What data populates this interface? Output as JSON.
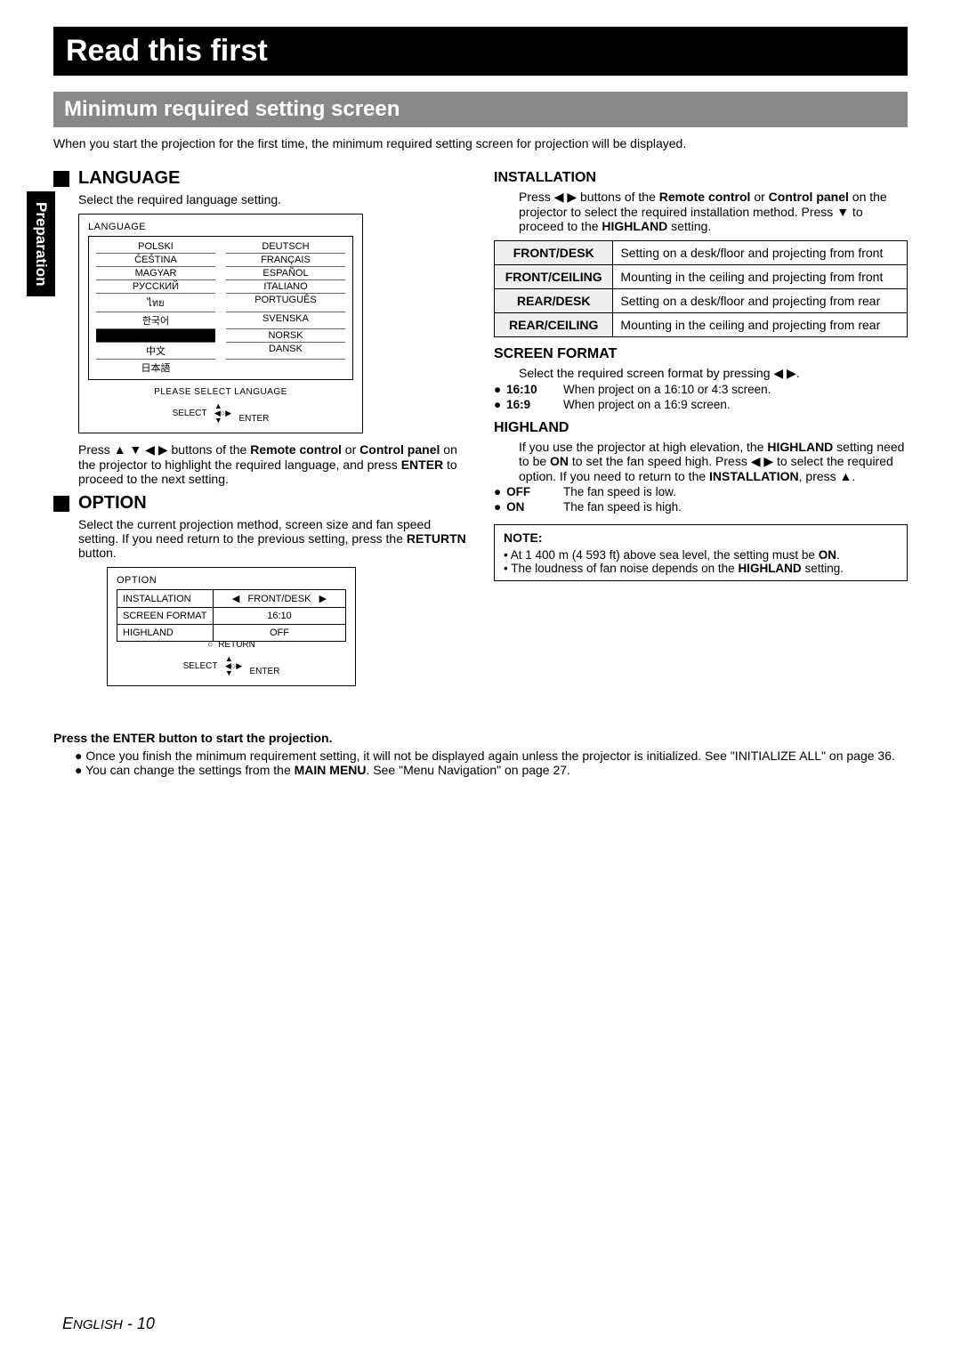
{
  "sideTab": "Preparation",
  "header": "Read this first",
  "subheader": "Minimum required setting screen",
  "intro": "When you start the projection for the first time, the minimum required setting screen for projection will be displayed.",
  "language": {
    "title": "LANGUAGE",
    "desc": "Select the required language setting.",
    "osdTitle": "LANGUAGE",
    "left": [
      "POLSKI",
      "ČEŠTINA",
      "MAGYAR",
      "РУССКИЙ",
      "ไทย",
      "한국어",
      "",
      "中文",
      "日本語"
    ],
    "right": [
      "DEUTSCH",
      "FRANÇAIS",
      "ESPAÑOL",
      "ITALIANO",
      "PORTUGUÊS",
      "SVENSKA",
      "NORSK",
      "DANSK",
      ""
    ],
    "please": "PLEASE SELECT LANGUAGE",
    "select": "SELECT",
    "enter": "ENTER",
    "instr": "Press ▲ ▼ ◀ ▶ buttons of the Remote control or Control panel on the projector to highlight the required language, and press ENTER to proceed to the next setting."
  },
  "option": {
    "title": "OPTION",
    "desc": "Select the current projection method, screen size and fan speed setting. If you need return to the previous setting, press the RETURTN button.",
    "osdTitle": "OPTION",
    "rows": [
      {
        "k": "INSTALLATION",
        "v": "FRONT/DESK",
        "arrows": true
      },
      {
        "k": "SCREEN FORMAT",
        "v": "16:10"
      },
      {
        "k": "HIGHLAND",
        "v": "OFF"
      }
    ],
    "return": "RETURN",
    "select": "SELECT",
    "enter": "ENTER"
  },
  "installation": {
    "title": "INSTALLATION",
    "desc": "Press ◀ ▶ buttons of the Remote control or Control panel on the projector to select the required installation method. Press ▼ to proceed to the HIGHLAND setting.",
    "rows": [
      {
        "k": "FRONT/DESK",
        "v": "Setting on a desk/floor and projecting from front"
      },
      {
        "k": "FRONT/CEILING",
        "v": "Mounting in the ceiling and projecting from front"
      },
      {
        "k": "REAR/DESK",
        "v": "Setting on a desk/floor and projecting from rear"
      },
      {
        "k": "REAR/CEILING",
        "v": "Mounting in the ceiling and projecting from rear"
      }
    ]
  },
  "screenformat": {
    "title": "SCREEN FORMAT",
    "desc": "Select the required screen format by pressing ◀ ▶.",
    "items": [
      {
        "k": "16:10",
        "v": "When project on a 16:10 or 4:3 screen."
      },
      {
        "k": "16:9",
        "v": "When project on a 16:9 screen."
      }
    ]
  },
  "highland": {
    "title": "HIGHLAND",
    "desc": "If you use the projector at high elevation, the HIGHLAND setting need to be ON to set the fan speed high. Press ◀ ▶ to select the required option. If you need to return to the INSTALLATION, press ▲.",
    "items": [
      {
        "k": "OFF",
        "v": "The fan speed is low."
      },
      {
        "k": "ON",
        "v": "The fan speed is high."
      }
    ]
  },
  "note": {
    "title": "NOTE:",
    "items": [
      "At 1 400 m (4 593 ft) above sea level, the setting must be ON.",
      "The loudness of fan noise depends on the HIGHLAND setting."
    ]
  },
  "bottom": {
    "lead": "Press the ENTER button to start the projection.",
    "items": [
      "Once you finish the minimum requirement setting, it will not be displayed again unless the projector is initialized. See \"INITIALIZE ALL\" on page 36.",
      "You can change the settings from the MAIN MENU. See \"Menu Navigation\" on page 27."
    ]
  },
  "footer": "ENGLISH - 10"
}
